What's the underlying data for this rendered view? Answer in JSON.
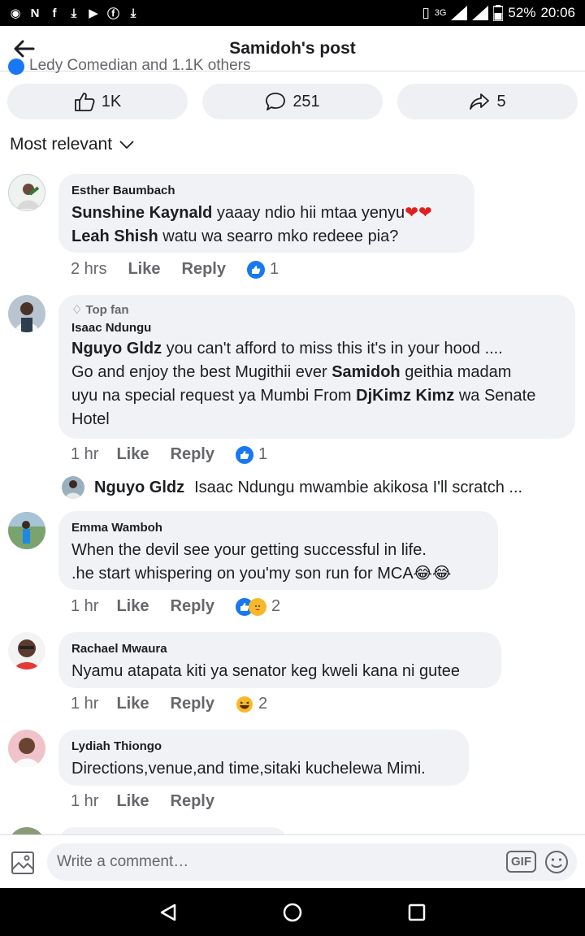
{
  "status_bar": {
    "battery": "52%",
    "time": "20:06",
    "network": "3G"
  },
  "header": {
    "title": "Samidoh's post"
  },
  "cutoff_text": "Ledy Comedian and 1.1K others",
  "actions": {
    "likes": "1K",
    "comments": "251",
    "shares": "5"
  },
  "filter": {
    "label": "Most relevant"
  },
  "comments": [
    {
      "author": "Esther Baumbach",
      "lines": [
        {
          "mention": "Sunshine Kaynald",
          "text": " yaaay ndio hii mtaa yenyu"
        },
        {
          "mention": "Leah Shish",
          "text": "  watu wa searro mko redeee pia?"
        }
      ],
      "time": "2 hrs",
      "like": "Like",
      "reply": "Reply",
      "reactions": "1"
    },
    {
      "badge": "Top fan",
      "author": "Isaac Ndungu",
      "body_line1_mention": "Nguyo Gldz",
      "body_line1": "  you can't afford to miss this it's in your hood ....",
      "body_line2_a": "Go and enjoy the best Mugithii ever ",
      "body_line2_mention": "Samidoh",
      "body_line2_b": " geithia madam",
      "body_line3_a": "uyu na special request ya Mumbi From ",
      "body_line3_mention": "DjKimz Kimz",
      "body_line3_b": " wa Senate",
      "body_line4": "Hotel",
      "time": "1 hr",
      "like": "Like",
      "reply": "Reply",
      "reactions": "1"
    },
    {
      "author": "Emma Wamboh",
      "line1": "When the devil see your getting successful in life.",
      "line2": ".he start whispering on you'my son run for MCA",
      "time": "1 hr",
      "like": "Like",
      "reply": "Reply",
      "reactions": "2"
    },
    {
      "author": "Rachael Mwaura",
      "line1": "Nyamu atapata kiti ya senator keg kweli kana ni gutee",
      "time": "1 hr",
      "like": "Like",
      "reply": "Reply",
      "reactions": "2"
    },
    {
      "author": "Lydiah Thiongo",
      "line1": "Directions,venue,and time,sitaki kuchelewa Mimi.",
      "time": "1 hr",
      "like": "Like",
      "reply": "Reply"
    }
  ],
  "reply_preview": {
    "author": "Nguyo Gldz",
    "text": "Isaac Ndungu mwambie akikosa I'll scratch ..."
  },
  "composer": {
    "placeholder": "Write a comment…",
    "gif": "GIF"
  },
  "colors": {
    "accent": "#1877f2",
    "bubble": "#f0f2f5",
    "muted": "#65676b"
  }
}
